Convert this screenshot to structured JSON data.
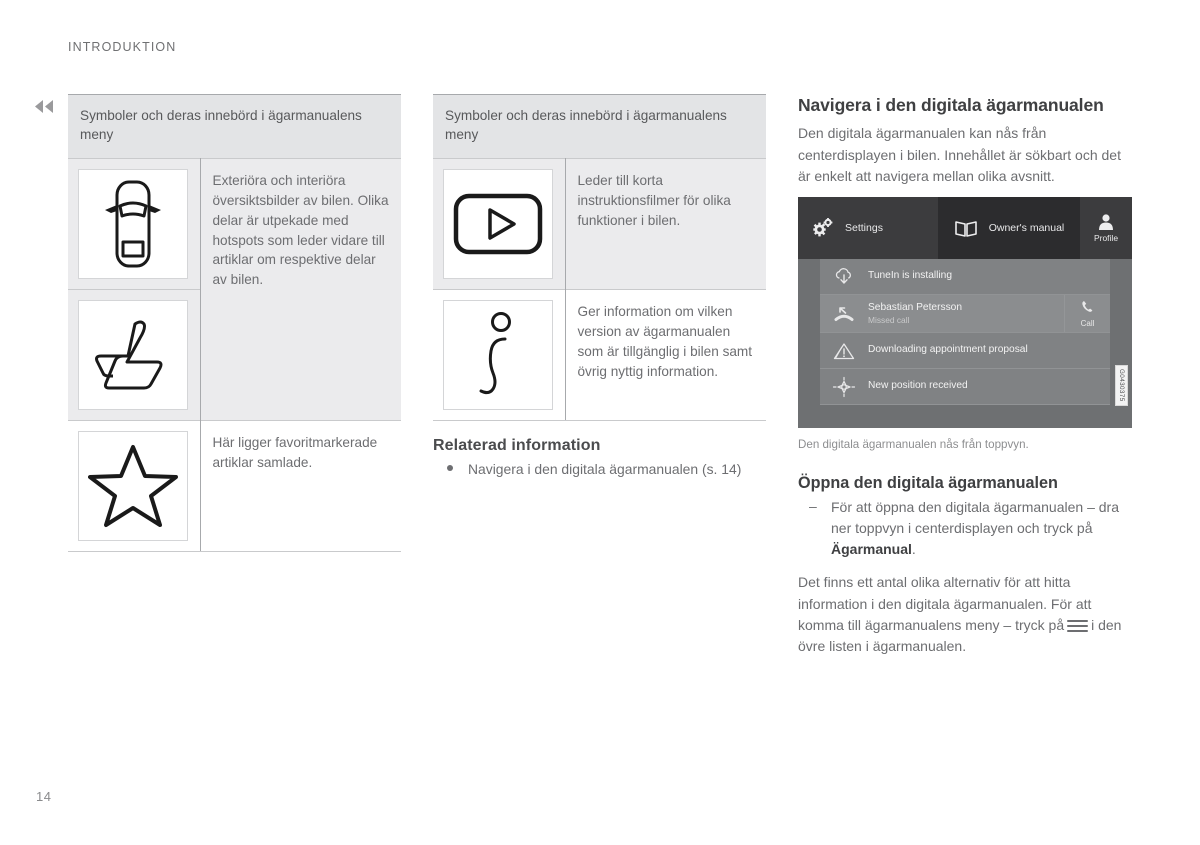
{
  "page": {
    "running_head": "INTRODUKTION",
    "page_number": "14",
    "back_marker_icon": "double-chevron-left-icon"
  },
  "column_1": {
    "table": {
      "caption": "Symboler och deras innebörd i ägarmanualens meny",
      "rows": [
        {
          "icon": "car-top-view-icon",
          "description": "Exteriöra och interiöra översiktsbilder av bilen. Olika delar är utpekade med hotspots som leder vidare till artiklar om respektive delar av bilen."
        },
        {
          "icon": "car-seat-icon",
          "description": ""
        },
        {
          "icon": "star-icon",
          "description": "Här ligger favoritmarkerade artiklar samlade."
        }
      ]
    }
  },
  "column_2": {
    "table": {
      "caption": "Symboler och deras innebörd i ägarmanualens meny",
      "rows": [
        {
          "icon": "play-video-icon",
          "description": "Leder till korta instruktionsfilmer för olika funktioner i bilen."
        },
        {
          "icon": "info-i-icon",
          "description": "Ger information om vilken version av ägarmanualen som är tillgänglig i bilen samt övrig nyttig information."
        }
      ]
    },
    "related": {
      "heading": "Relaterad information",
      "items": [
        "Navigera i den digitala ägarmanualen (s. 14)"
      ]
    }
  },
  "column_3": {
    "heading": "Navigera i den digitala ägarmanualen",
    "intro": "Den digitala ägarmanualen kan nås från centerdisplayen i bilen. Innehållet är sökbart och det är enkelt att navigera mellan olika avsnitt.",
    "screen": {
      "topbar": [
        {
          "label": "Settings",
          "icon": "gears-icon",
          "active": false
        },
        {
          "label": "Owner's manual",
          "icon": "open-book-icon",
          "active": true
        },
        {
          "label": "Profile",
          "icon": "person-icon",
          "active": false
        }
      ],
      "notifications": [
        {
          "icon": "cloud-download-icon",
          "title": "TuneIn is installing",
          "subtitle": "",
          "action": ""
        },
        {
          "icon": "missed-call-icon",
          "title": "Sebastian Petersson",
          "subtitle": "Missed call",
          "action": "Call",
          "action_icon": "phone-icon"
        },
        {
          "icon": "warning-triangle-icon",
          "title": "Downloading appointment proposal",
          "subtitle": "",
          "action": ""
        },
        {
          "icon": "compass-crosshair-icon",
          "title": "New position received",
          "subtitle": "",
          "action": ""
        }
      ],
      "image_code": "G0430375"
    },
    "figure_caption": "Den digitala ägarmanualen nås från toppvyn.",
    "subheading": "Öppna den digitala ägarmanualen",
    "step_prefix": "För att öppna den digitala ägarmanualen – dra ner toppvyn i centerdisplayen och tryck på ",
    "step_bold": "Ägarmanual",
    "step_suffix": ".",
    "para_a": "Det finns ett antal olika alternativ för att hitta information i den digitala ägarmanualen. För att",
    "para_b_start": "komma till ägarmanualens meny – tryck på",
    "para_b_end": "i den övre listen i ägarmanualen."
  },
  "colors": {
    "text": "#6d6e71",
    "heading": "#3f4042",
    "table_caption_bg": "#e3e4e6",
    "table_row_bg": "#ebebed",
    "screen_bg": "#6e7072",
    "screen_topbar": "#3c3c3e",
    "screen_topbar_active": "#2c2c2e"
  }
}
